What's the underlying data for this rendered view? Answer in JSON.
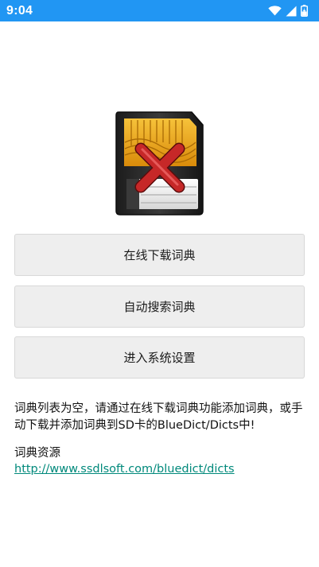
{
  "status_bar": {
    "time": "9:04",
    "icons": [
      "wifi-icon",
      "signal-icon",
      "battery-icon"
    ],
    "color": "#2196f3"
  },
  "buttons": {
    "download_online": "在线下载词典",
    "auto_search": "自动搜索词典",
    "system_settings": "进入系统设置"
  },
  "message": "词典列表为空，请通过在线下载词典功能添加词典，或手动下载并添加词典到SD卡的BlueDict/Dicts中!",
  "resources": {
    "title": "词典资源",
    "link": "http://www.ssdlsoft.com/bluedict/dicts",
    "link_color": "#00897b"
  },
  "illustration": {
    "icon": "sd-card-error-icon",
    "accent_color": "#c62828"
  }
}
